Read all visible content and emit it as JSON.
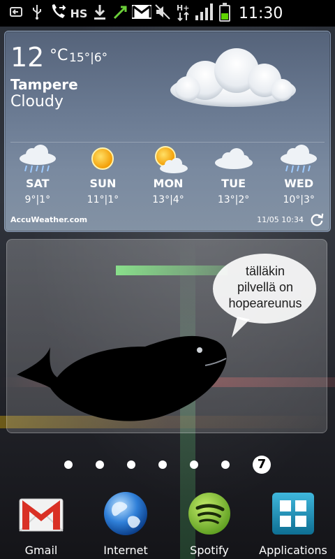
{
  "status_bar": {
    "icons": [
      "back-icon",
      "usb-icon",
      "call-forward-icon",
      "download-icon",
      "sync-icon",
      "gmail-icon",
      "mute-icon",
      "hplus-data-icon",
      "signal-icon",
      "battery-charging-icon"
    ],
    "hs_text": "HS",
    "hplus_text": "H+",
    "battery_level": 0.45,
    "clock": "11:30"
  },
  "weather": {
    "temperature": "12",
    "unit": "°C",
    "range": "15°|6°",
    "city": "Tampere",
    "condition": "Cloudy",
    "forecast": [
      {
        "day": "SAT",
        "range": "9°|1°",
        "icon": "rain-cloud-icon"
      },
      {
        "day": "SUN",
        "range": "11°|1°",
        "icon": "sun-icon"
      },
      {
        "day": "MON",
        "range": "13°|4°",
        "icon": "sun-cloud-icon"
      },
      {
        "day": "TUE",
        "range": "13°|2°",
        "icon": "cloud-icon"
      },
      {
        "day": "WED",
        "range": "10°|3°",
        "icon": "rain-cloud-icon"
      }
    ],
    "provider": "AccuWeather.com",
    "updated": "11/05 10:34"
  },
  "picture_frame": {
    "bubble_lines": [
      "tälläkin",
      "pilvellä on",
      "hopeareunus"
    ]
  },
  "home_pages": {
    "current_page": "7"
  },
  "dock": {
    "apps": [
      {
        "label": "Gmail",
        "icon": "gmail-icon"
      },
      {
        "label": "Internet",
        "icon": "globe-icon"
      },
      {
        "label": "Spotify",
        "icon": "spotify-icon"
      },
      {
        "label": "Applications",
        "icon": "apps-grid-icon"
      }
    ]
  },
  "colors": {
    "battery": "#5fd400",
    "gmail_red": "#d93025",
    "spotify_green": "#8bc34a",
    "apps_teal": "#1a8fb3"
  }
}
